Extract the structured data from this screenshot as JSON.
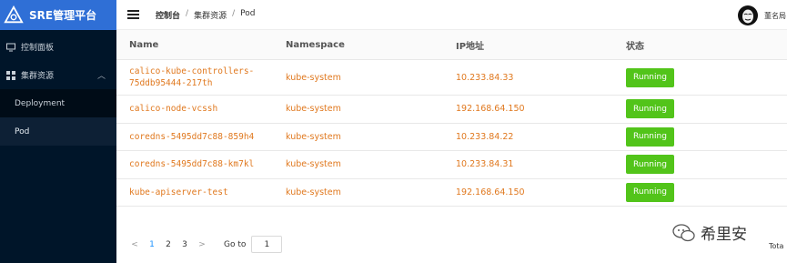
{
  "app": {
    "title": "SRE管理平台"
  },
  "sidebar": {
    "items": [
      {
        "label": "控制面板",
        "icon": "monitor-icon"
      },
      {
        "label": "集群资源",
        "icon": "grid-icon",
        "expanded": true,
        "children": [
          {
            "label": "Deployment",
            "active": false
          },
          {
            "label": "Pod",
            "active": true
          }
        ]
      }
    ]
  },
  "header": {
    "breadcrumb": [
      "控制台",
      "集群资源",
      "Pod"
    ],
    "user": {
      "name": "董名局",
      "avatar": "anonymous-mask-avatar"
    }
  },
  "table": {
    "columns": [
      "Name",
      "Namespace",
      "IP地址",
      "状态"
    ],
    "rows": [
      {
        "name": "calico-kube-controllers-75ddb95444-217th",
        "namespace": "kube-system",
        "ip": "10.233.84.33",
        "status": "Running"
      },
      {
        "name": "calico-node-vcssh",
        "namespace": "kube-system",
        "ip": "192.168.64.150",
        "status": "Running"
      },
      {
        "name": "coredns-5495dd7c88-859h4",
        "namespace": "kube-system",
        "ip": "10.233.84.22",
        "status": "Running"
      },
      {
        "name": "coredns-5495dd7c88-km7kl",
        "namespace": "kube-system",
        "ip": "10.233.84.31",
        "status": "Running"
      },
      {
        "name": "kube-apiserver-test",
        "namespace": "kube-system",
        "ip": "192.168.64.150",
        "status": "Running"
      }
    ]
  },
  "pagination": {
    "prev": "<",
    "next": ">",
    "pages": [
      "1",
      "2",
      "3"
    ],
    "current": "1",
    "goto_label": "Go to",
    "goto_value": "1",
    "total_label": "Tota"
  },
  "watermark": {
    "text": "希里安"
  },
  "colors": {
    "sidebar_bg": "#001529",
    "logo_bar": "#2f6fd6",
    "accent_text": "#e0781e",
    "status_running": "#52c41a",
    "page_active": "#1890ff"
  }
}
